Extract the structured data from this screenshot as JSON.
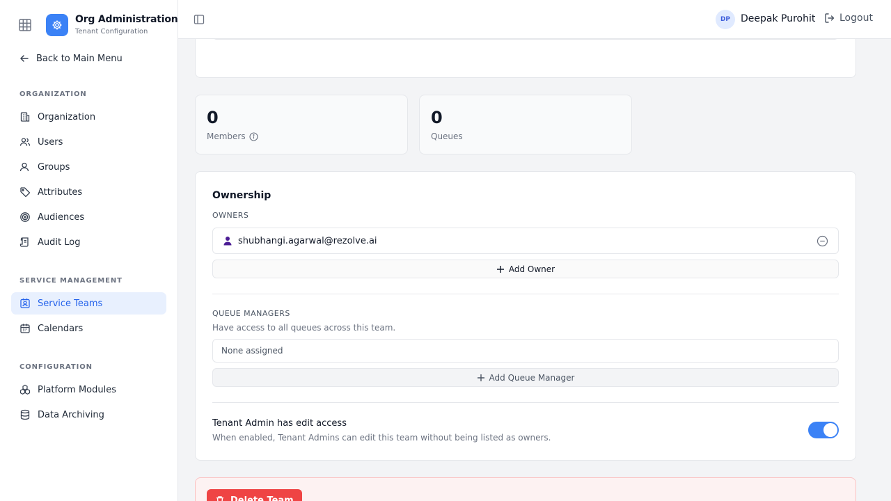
{
  "brand": {
    "title": "Org Administration",
    "subtitle": "Tenant Configuration",
    "logo_icon": "gear-icon",
    "apps_icon": "grid-icon"
  },
  "back_link": "Back to Main Menu",
  "sidebar": {
    "sections": [
      {
        "heading": "ORGANIZATION",
        "items": [
          {
            "label": "Organization",
            "icon": "building-icon"
          },
          {
            "label": "Users",
            "icon": "users-icon"
          },
          {
            "label": "Groups",
            "icon": "group-icon"
          },
          {
            "label": "Attributes",
            "icon": "tag-icon"
          },
          {
            "label": "Audiences",
            "icon": "target-icon"
          },
          {
            "label": "Audit Log",
            "icon": "log-icon"
          }
        ]
      },
      {
        "heading": "SERVICE MANAGEMENT",
        "items": [
          {
            "label": "Service Teams",
            "icon": "contact-icon",
            "active": true
          },
          {
            "label": "Calendars",
            "icon": "calendar-icon"
          }
        ]
      },
      {
        "heading": "CONFIGURATION",
        "items": [
          {
            "label": "Platform Modules",
            "icon": "boxes-icon"
          },
          {
            "label": "Data Archiving",
            "icon": "database-icon"
          }
        ]
      }
    ]
  },
  "header": {
    "user_initials": "DP",
    "user_name": "Deepak Purohit",
    "logout_label": "Logout"
  },
  "stats": [
    {
      "value": "0",
      "label": "Members",
      "has_info": true
    },
    {
      "value": "0",
      "label": "Queues"
    }
  ],
  "ownership": {
    "title": "Ownership",
    "owners_heading": "OWNERS",
    "owners": [
      {
        "email": "shubhangi.agarwal@rezolve.ai"
      }
    ],
    "add_owner_label": "Add Owner",
    "queue_managers_heading": "QUEUE MANAGERS",
    "queue_managers_help": "Have access to all queues across this team.",
    "queue_managers_empty": "None assigned",
    "add_queue_manager_label": "Add Queue Manager",
    "tenant_admin_title": "Tenant Admin has edit access",
    "tenant_admin_help": "When enabled, Tenant Admins can edit this team without being listed as owners.",
    "tenant_admin_enabled": true
  },
  "danger": {
    "delete_label": "Delete Team"
  },
  "colors": {
    "accent": "#3b82f6",
    "active_bg": "#e8f0fe",
    "danger": "#ef4444"
  }
}
